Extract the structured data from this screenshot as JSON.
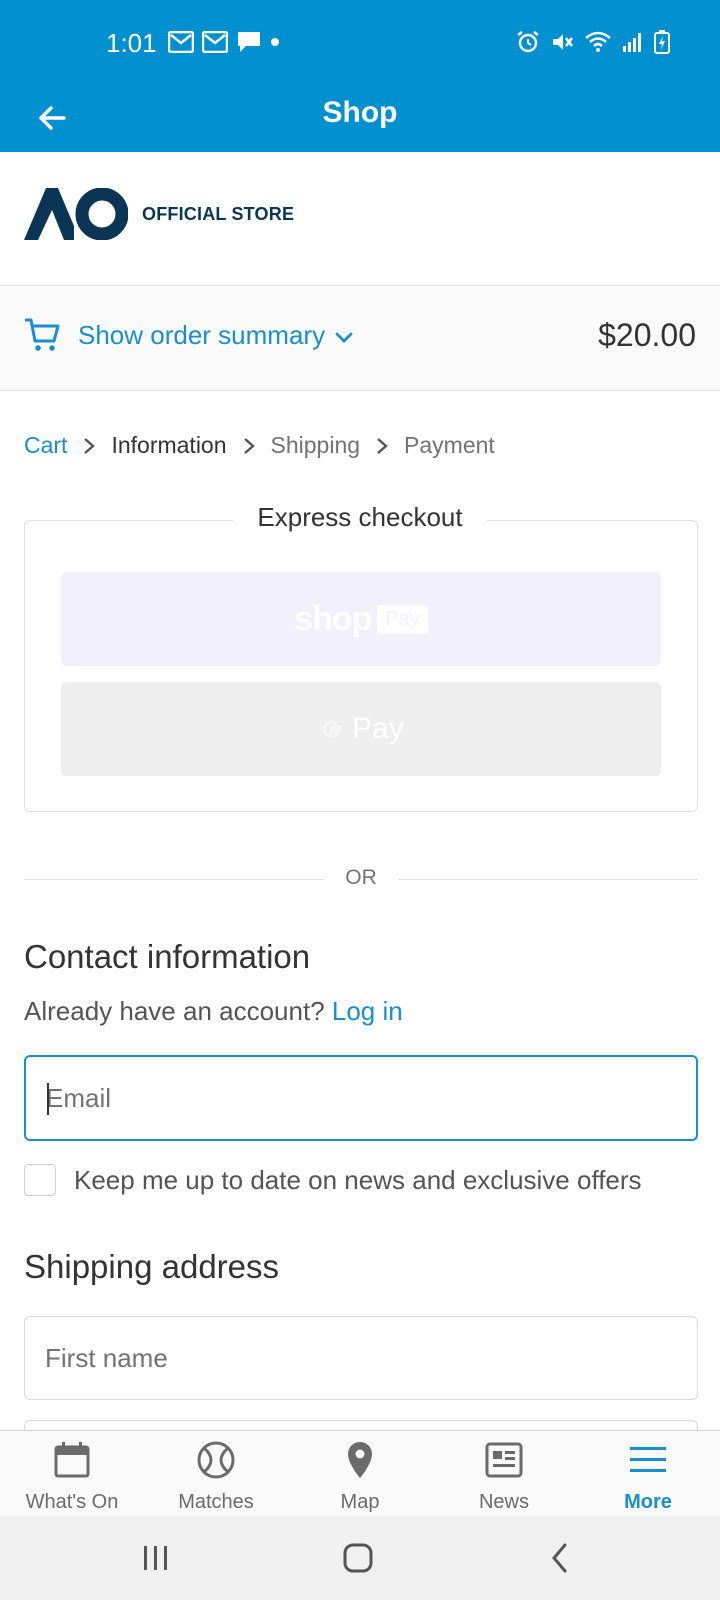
{
  "status_bar": {
    "time": "1:01",
    "left_icons": [
      "gmail-icon",
      "gmail-icon",
      "message-icon",
      "dot-icon"
    ],
    "right_icons": [
      "alarm-icon",
      "mute-icon",
      "wifi-icon",
      "signal-icon",
      "battery-icon"
    ]
  },
  "app_bar": {
    "title": "Shop"
  },
  "store": {
    "logo_text": "OFFICIAL STORE"
  },
  "order_summary": {
    "toggle_label": "Show order summary",
    "total": "$20.00"
  },
  "breadcrumb": {
    "cart": "Cart",
    "information": "Information",
    "shipping": "Shipping",
    "payment": "Payment"
  },
  "express_checkout": {
    "title": "Express checkout",
    "shop_pay_text": "shop",
    "shop_pay_badge": "Pay",
    "gpay_text": "Pay"
  },
  "divider": {
    "or": "OR"
  },
  "contact": {
    "heading": "Contact information",
    "already_text": "Already have an account?",
    "login_link": "Log in",
    "email_placeholder": "Email",
    "email_value": "",
    "marketing_checkbox_label": "Keep me up to date on news and exclusive offers",
    "marketing_checked": false
  },
  "shipping": {
    "heading": "Shipping address",
    "first_name_placeholder": "First name"
  },
  "bottom_nav": {
    "items": [
      {
        "label": "What's On",
        "icon": "calendar-icon",
        "active": false
      },
      {
        "label": "Matches",
        "icon": "tennis-ball-icon",
        "active": false
      },
      {
        "label": "Map",
        "icon": "map-pin-icon",
        "active": false
      },
      {
        "label": "News",
        "icon": "news-icon",
        "active": false
      },
      {
        "label": "More",
        "icon": "hamburger-icon",
        "active": true
      }
    ]
  },
  "colors": {
    "brand_blue": "#0090d0",
    "link_blue": "#1a8fcf",
    "navy": "#0b3554"
  }
}
